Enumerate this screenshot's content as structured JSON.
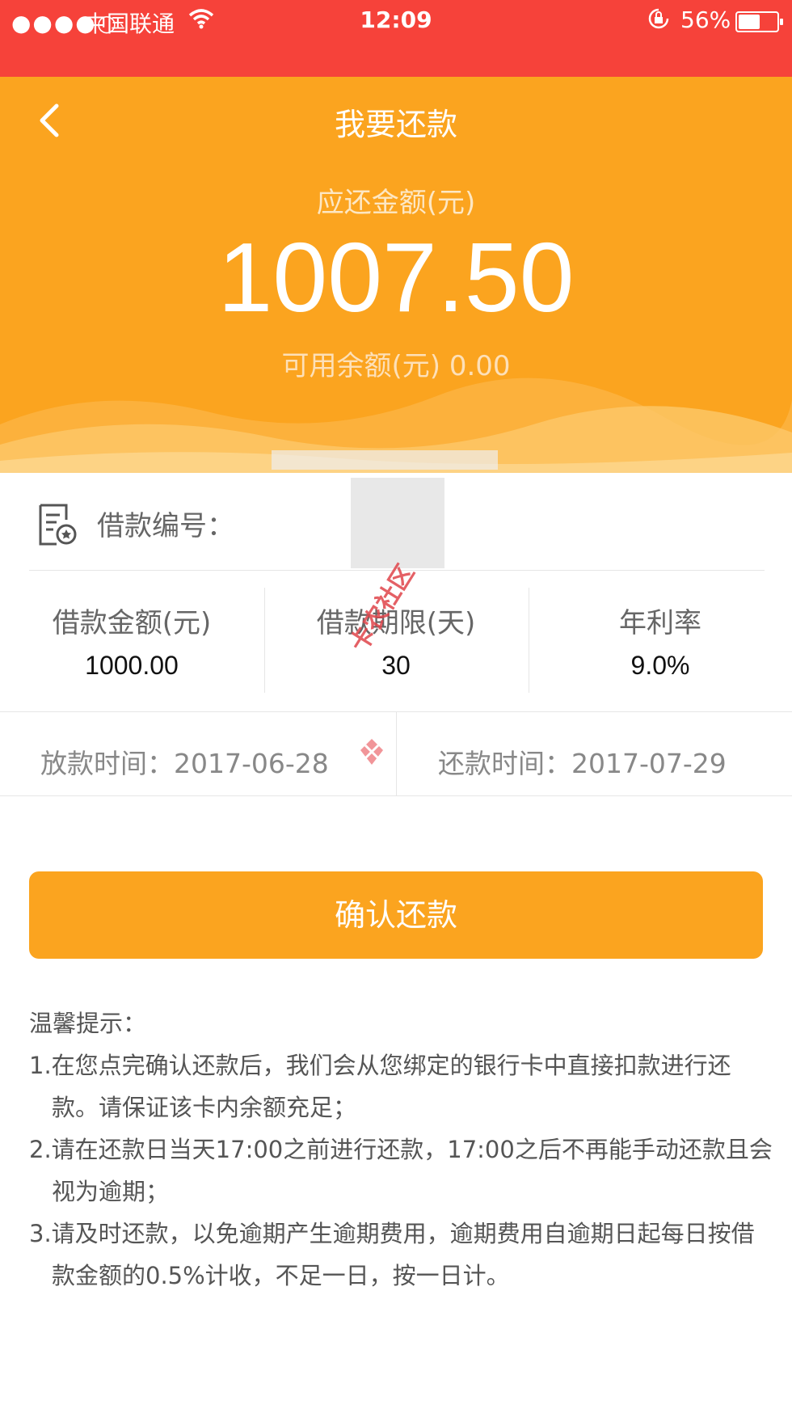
{
  "status_bar": {
    "signal": "●●●●○",
    "carrier": "中国联通",
    "time": "12:09",
    "battery_percent": "56%",
    "battery_level": 0.56,
    "icons": [
      "signal-icon",
      "wifi-icon",
      "orientation-lock-icon",
      "battery-icon"
    ]
  },
  "header": {
    "title": "我要还款"
  },
  "summary": {
    "due_label": "应还金额(元)",
    "due_amount": "1007.50",
    "balance_label": "可用余额(元)",
    "balance_value": "0.00"
  },
  "loan": {
    "number_label": "借款编号：",
    "stats": [
      {
        "label": "借款金额(元)",
        "value": "1000.00"
      },
      {
        "label": "借款期限(天)",
        "value": "30"
      },
      {
        "label": "年利率",
        "value": "9.0%"
      }
    ],
    "disburse_label": "放款时间：",
    "disburse_date": "2017-06-28",
    "repay_label": "还款时间：",
    "repay_date": "2017-07-29"
  },
  "watermark": "卡农社区",
  "confirm_button": "确认还款",
  "tips": {
    "title": "温馨提示：",
    "items": [
      "1.在您点完确认还款后，我们会从您绑定的银行卡中直接扣款进行还款。请保证该卡内余额充足；",
      "2.请在还款日当天17:00之前进行还款，17:00之后不再能手动还款且会视为逾期；",
      "3.请及时还款，以免逾期产生逾期费用，逾期费用自逾期日起每日按借款金额的0.5%计收，不足一日，按一日计。"
    ]
  },
  "colors": {
    "status_bar": "#f6423a",
    "accent": "#fba41f"
  }
}
